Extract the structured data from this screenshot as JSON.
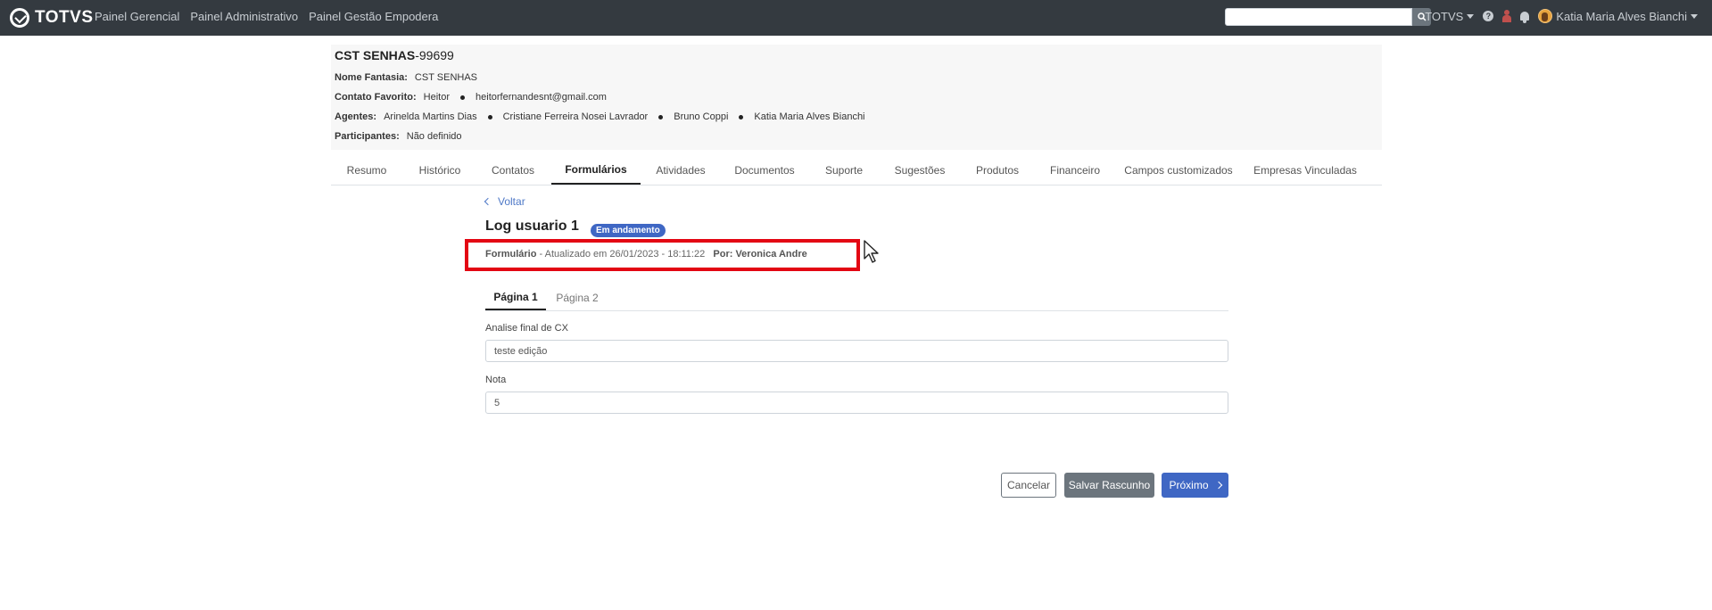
{
  "topbar": {
    "logo_text": "TOTVS",
    "nav": [
      "Painel Gerencial",
      "Painel Administrativo",
      "Painel Gestão Empodera"
    ],
    "search": {
      "value": "",
      "placeholder": ""
    },
    "brand_menu": "TOTVS",
    "user_name": "Katia Maria Alves Bianchi",
    "help_glyph": "?"
  },
  "header": {
    "company_name": "CST SENHAS",
    "company_code": "-99699",
    "nome_fantasia_label": "Nome Fantasia:",
    "nome_fantasia": "CST SENHAS",
    "contato_label": "Contato Favorito:",
    "contato_name": "Heitor",
    "contato_email": "heitorfernandesnt@gmail.com",
    "agentes_label": "Agentes:",
    "agentes": [
      "Arinelda Martins Dias",
      "Cristiane Ferreira Nosei Lavrador",
      "Bruno Coppi",
      "Katia Maria Alves Bianchi"
    ],
    "participantes_label": "Participantes:",
    "participantes": "Não definido"
  },
  "tabs": [
    "Resumo",
    "Histórico",
    "Contatos",
    "Formulários",
    "Atividades",
    "Documentos",
    "Suporte",
    "Sugestões",
    "Produtos",
    "Financeiro",
    "Campos customizados",
    "Empresas Vinculadas"
  ],
  "active_tab": "Formulários",
  "form": {
    "back_label": "Voltar",
    "title": "Log usuario 1",
    "status": "Em andamento",
    "meta_type": "Formulário",
    "meta_updated": " - Atualizado em 26/01/2023 - 18:11:22",
    "meta_by": "Por: Veronica Andre",
    "pages": [
      "Página 1",
      "Página 2"
    ],
    "fields": [
      {
        "label": "Analise final de CX",
        "value": "teste edição"
      },
      {
        "label": "Nota",
        "value": "5"
      }
    ],
    "buttons": {
      "cancel": "Cancelar",
      "draft": "Salvar Rascunho",
      "next": "Próximo"
    }
  },
  "colors": {
    "topbar": "#343a40",
    "primary": "#3f67c4",
    "highlight": "#e30613",
    "secondary": "#6c757d"
  }
}
